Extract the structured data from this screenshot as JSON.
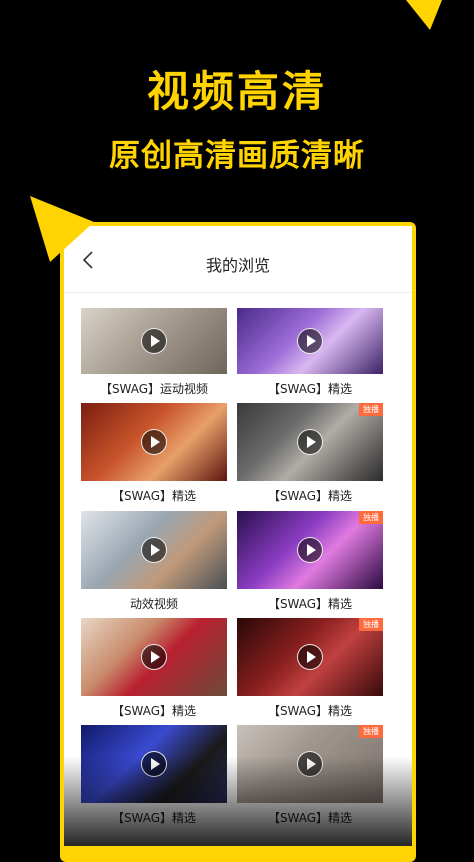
{
  "promo": {
    "title": "视频高清",
    "subtitle": "原创高清画质清晰",
    "accent_color": "#FFD400"
  },
  "header": {
    "back_icon": "chevron-left-icon",
    "title": "我的浏览"
  },
  "videos": [
    {
      "caption": "【SWAG】运动视频",
      "badge": ""
    },
    {
      "caption": "【SWAG】精选",
      "badge": ""
    },
    {
      "caption": "【SWAG】精选",
      "badge": ""
    },
    {
      "caption": "【SWAG】精选",
      "badge": "独播"
    },
    {
      "caption": "动效视频",
      "badge": ""
    },
    {
      "caption": "【SWAG】精选",
      "badge": "独播"
    },
    {
      "caption": "【SWAG】精选",
      "badge": ""
    },
    {
      "caption": "【SWAG】精选",
      "badge": "独播"
    },
    {
      "caption": "【SWAG】精选",
      "badge": ""
    },
    {
      "caption": "【SWAG】精选",
      "badge": "独播"
    }
  ],
  "play_icon": "play-icon"
}
